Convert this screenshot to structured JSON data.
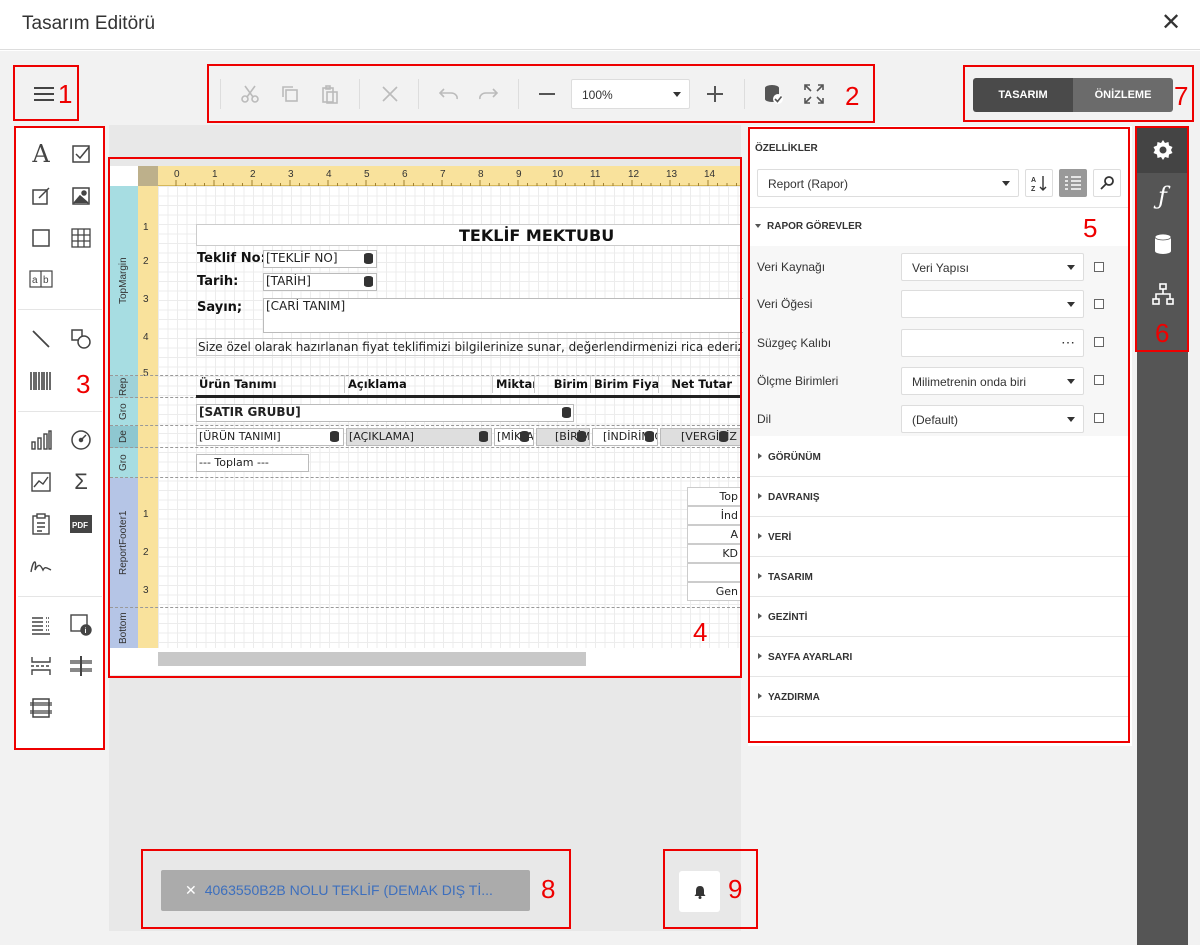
{
  "window": {
    "title": "Tasarım Editörü"
  },
  "toolbar": {
    "zoom": "100%"
  },
  "tabs": {
    "design": "TASARIM",
    "preview": "ÖNİZLEME"
  },
  "report": {
    "title": "TEKLİF MEKTUBU",
    "teklif_no_label": "Teklif No:",
    "teklif_no_value": "[TEKLİF NO]",
    "tarih_label": "Tarih:",
    "tarih_value": "[TARİH]",
    "sayin_label": "Sayın;",
    "cari_value": "[CARİ TANIM]",
    "intro": "Size özel olarak hazırlanan fiyat teklifimizi bilgilerinize sunar, değerlendirmenizi rica ederiz.",
    "columns": [
      "Ürün Tanımı",
      "Açıklama",
      "Miktar",
      "Birim",
      "Birim Fiyat",
      "Net Tutar"
    ],
    "group_field": "[SATIR GRUBU]",
    "detail_cells": [
      "[ÜRÜN TANIMI]",
      "[AÇIKLAMA]",
      "[MİKTAR]",
      "[BİRİM]",
      "[İNDİRİM ORANI]",
      "[VERGİSİZ TUTAR]"
    ],
    "group_footer": "--- Toplam ---",
    "totals": [
      "Top",
      "İnd",
      "A",
      "KD",
      "",
      "Gen"
    ]
  },
  "bands": {
    "top_margin": "TopMargin",
    "report_header": "Rep",
    "group_header": "Gro",
    "detail": "De",
    "group_footer": "Gro",
    "report_footer": "ReportFooter1",
    "bottom_margin": "Bottom"
  },
  "ruler": {
    "top": [
      "0",
      "1",
      "2",
      "3",
      "4",
      "5",
      "6",
      "7",
      "8",
      "9",
      "10",
      "11",
      "12",
      "13",
      "14"
    ],
    "left1": [
      "1",
      "2",
      "3",
      "4",
      "5"
    ],
    "left2": [
      "1",
      "2",
      "3"
    ]
  },
  "properties": {
    "header": "ÖZELLİKLER",
    "object": "Report (Rapor)",
    "expanded_section": "RAPOR GÖREVLER",
    "rows": [
      {
        "label": "Veri Kaynağı",
        "value": "Veri Yapısı"
      },
      {
        "label": "Veri Öğesi",
        "value": ""
      },
      {
        "label": "Süzgeç Kalıbı",
        "value": ""
      },
      {
        "label": "Ölçme Birimleri",
        "value": "Milimetrenin onda biri"
      },
      {
        "label": "Dil",
        "value": "(Default)"
      }
    ],
    "sections": [
      "GÖRÜNÜM",
      "DAVRANIŞ",
      "VERİ",
      "TASARIM",
      "GEZİNTİ",
      "SAYFA AYARLARI",
      "YAZDIRMA"
    ]
  },
  "notification": {
    "text": "4063550B2B NOLU TEKLİF (DEMAK DIŞ Tİ..."
  },
  "annotations": [
    "1",
    "2",
    "3",
    "4",
    "5",
    "6",
    "7",
    "8",
    "9"
  ],
  "colors": {
    "accent_red": "#e00000",
    "active_tab": "#4a4a4a",
    "inactive_tab": "#6b6b6b",
    "band": "#a7dde2",
    "ruler": "#f9e29c"
  }
}
